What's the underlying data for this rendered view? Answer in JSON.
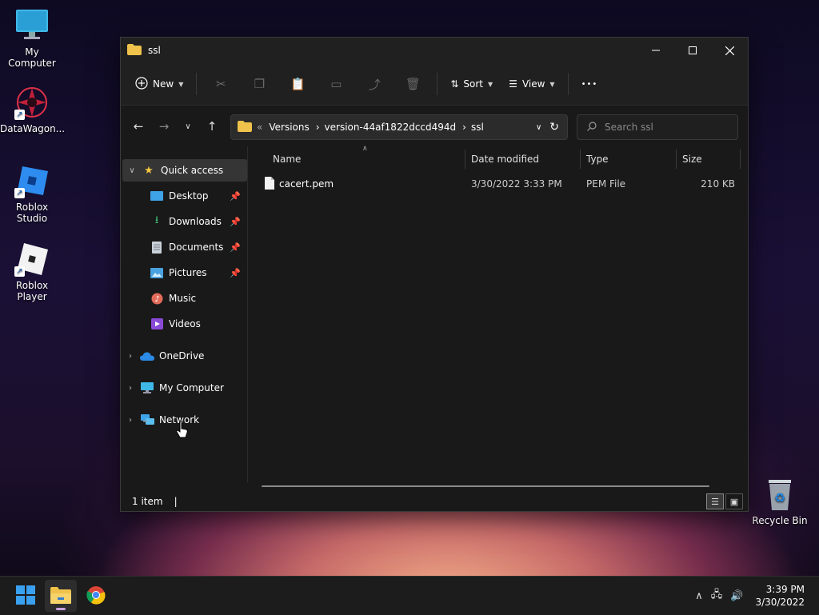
{
  "desktop": {
    "icons": [
      {
        "label": "My Computer"
      },
      {
        "label": "DataWagon..."
      },
      {
        "label": "Roblox Studio"
      },
      {
        "label": "Roblox Player"
      },
      {
        "label": "Recycle Bin"
      }
    ]
  },
  "window": {
    "title": "ssl",
    "toolbar": {
      "new_label": "New",
      "sort_label": "Sort",
      "view_label": "View",
      "more_symbol": "•••"
    },
    "address": {
      "sep": "«",
      "crumbs": [
        "Versions",
        "version-44af1822dccd494d",
        "ssl"
      ]
    },
    "search": {
      "placeholder": "Search ssl"
    },
    "sidebar": {
      "quick_access": "Quick access",
      "items": [
        "Desktop",
        "Downloads",
        "Documents",
        "Pictures",
        "Music",
        "Videos"
      ],
      "onedrive": "OneDrive",
      "my_computer": "My Computer",
      "network": "Network"
    },
    "columns": [
      "Name",
      "Date modified",
      "Type",
      "Size"
    ],
    "files": [
      {
        "name": "cacert.pem",
        "date": "3/30/2022 3:33 PM",
        "type": "PEM File",
        "size": "210 KB"
      }
    ],
    "status": "1 item",
    "status_sep": "|"
  },
  "taskbar": {
    "time": "3:39 PM",
    "date": "3/30/2022"
  },
  "colors": {
    "accent": "#0078d4",
    "folder": "#f0c24b",
    "star": "#f5c842"
  }
}
